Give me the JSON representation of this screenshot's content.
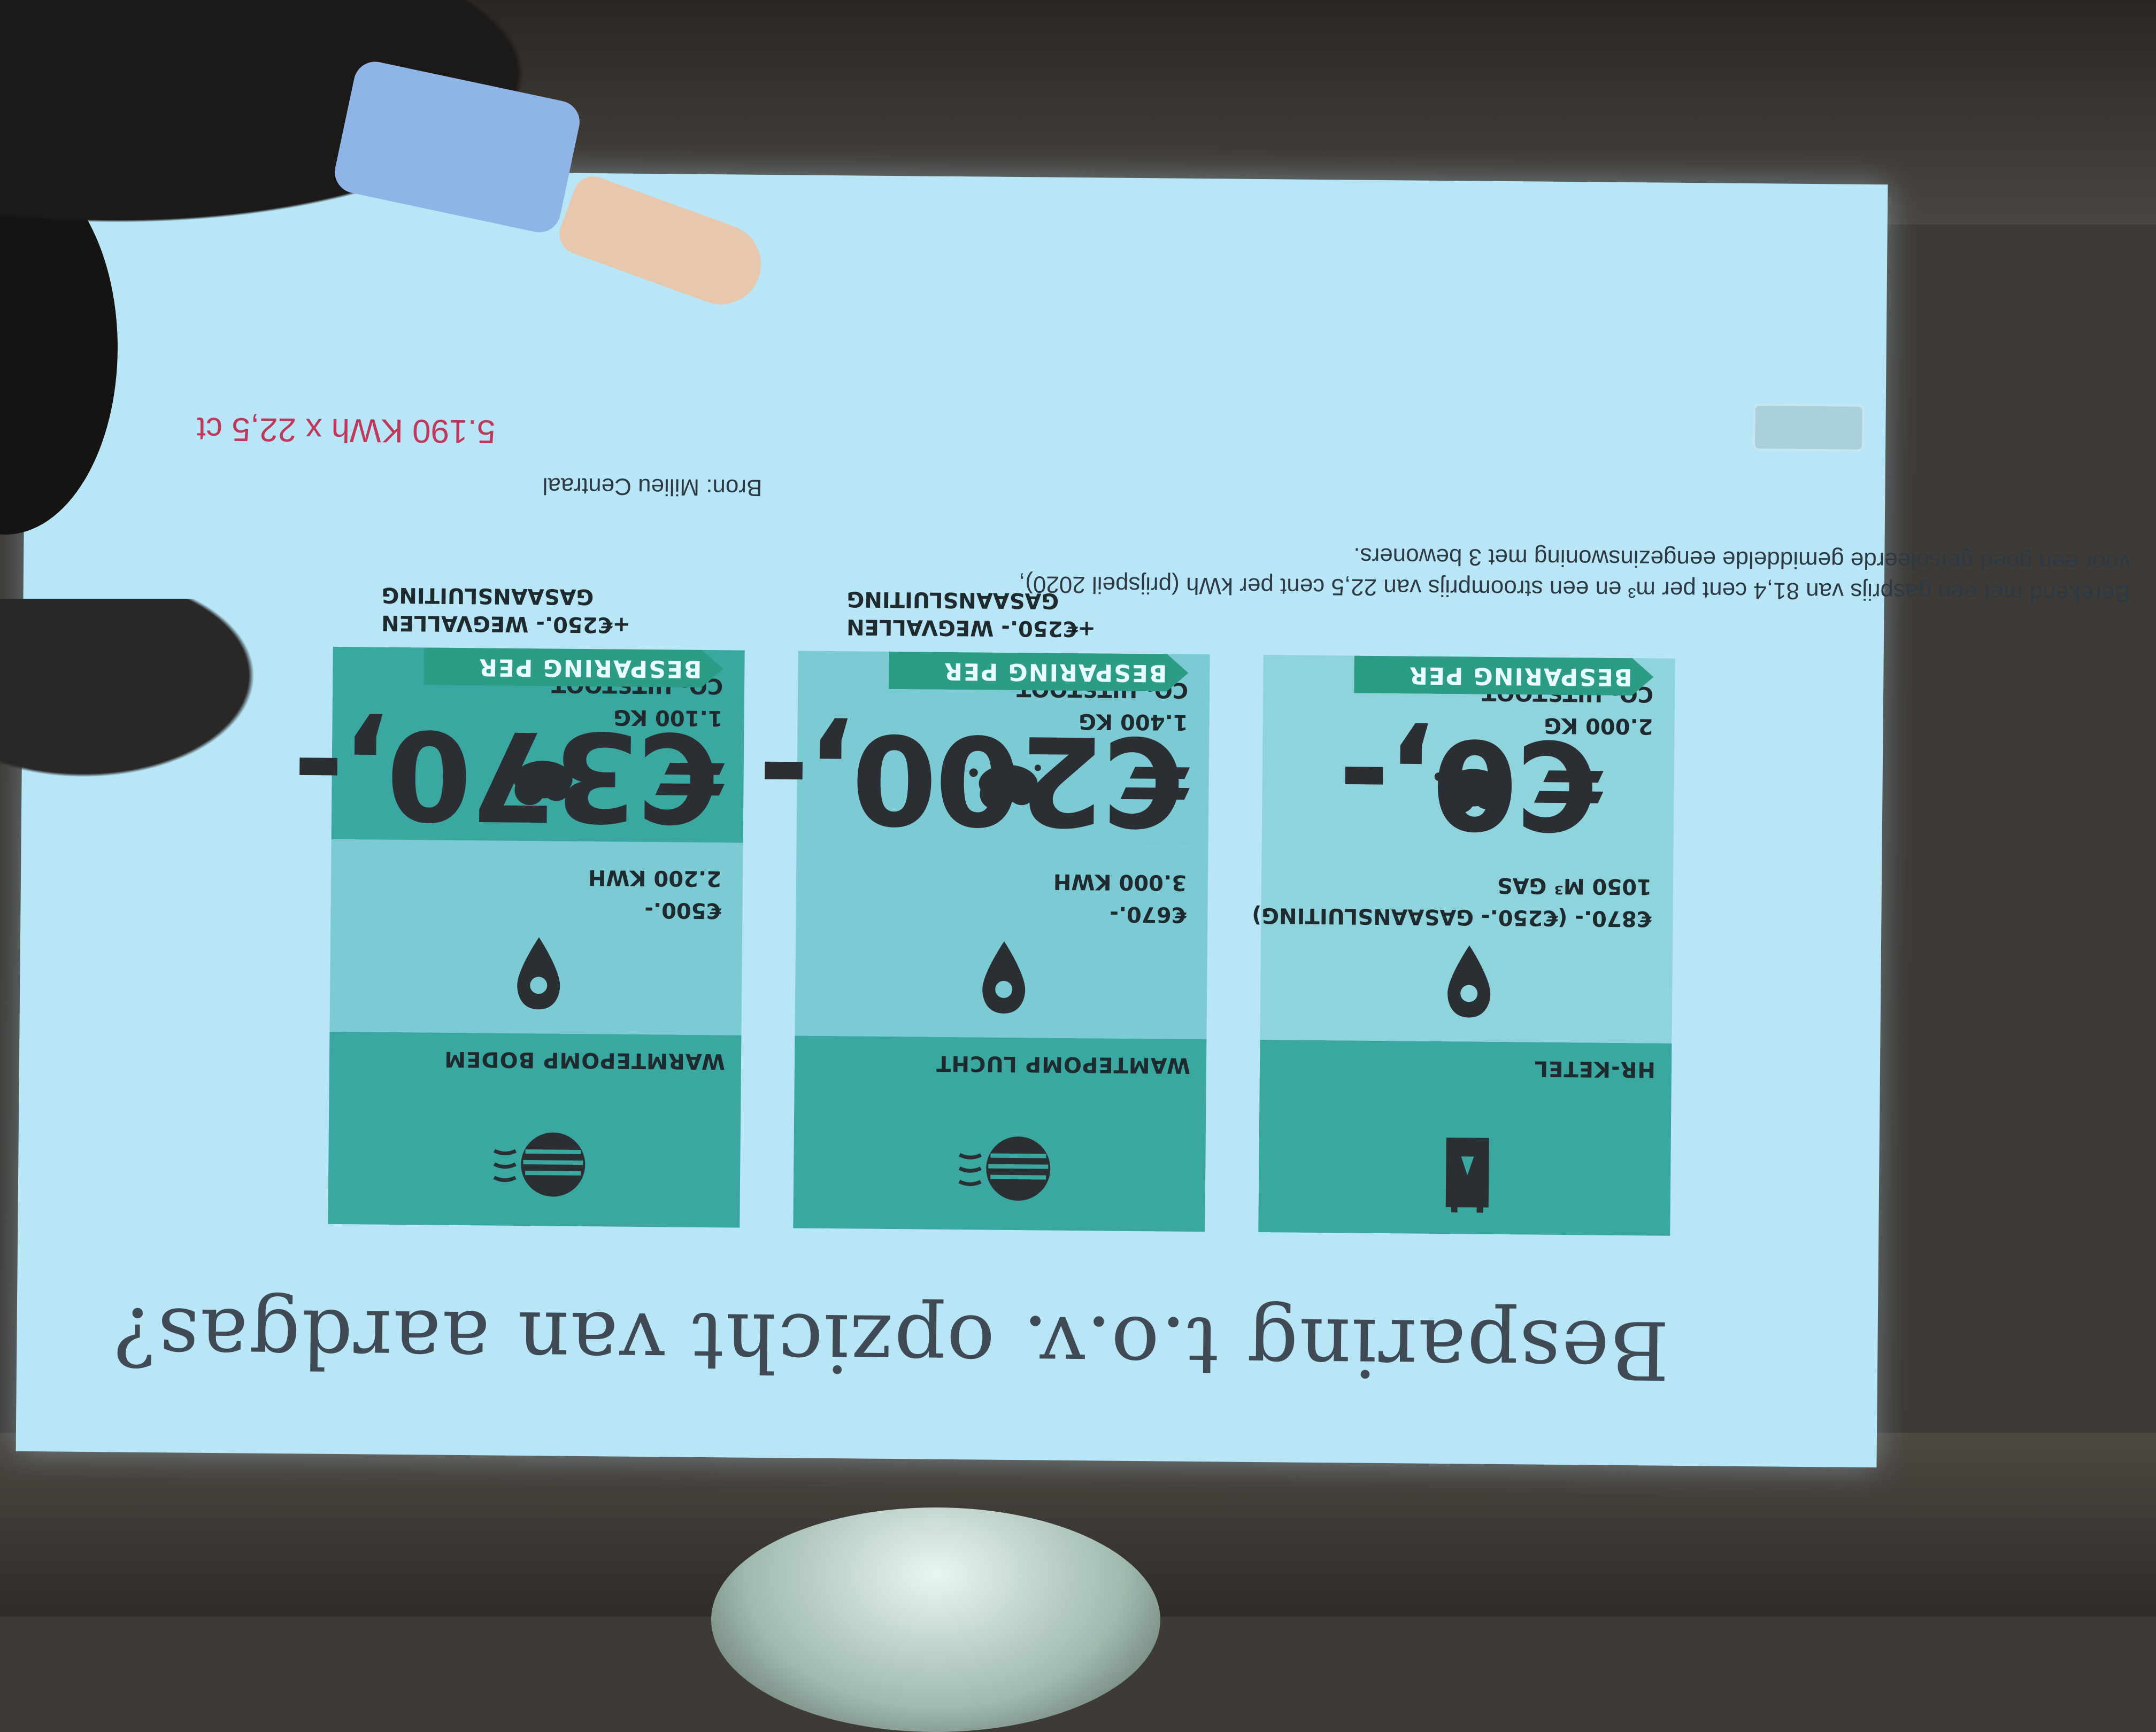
{
  "slide": {
    "title": "Besparing t.o.v. opzicht van aardgas?",
    "columns": [
      {
        "system_label": "HR-KETEL",
        "icon_system": "boiler-icon",
        "cost_line1": "€870.- (€250.- GASAANSLUITING)",
        "cost_line2": "1050 M³ GAS",
        "co2_line1": "2.000 KG",
        "co2_line2": "CO₂ UITSTOOT",
        "price": "€0,-",
        "banner": "BESPARING PER JAAR",
        "extra": ""
      },
      {
        "system_label": "WAMTEPOMP LUCHT",
        "icon_system": "heat-pump-air-icon",
        "cost_line1": "€670.-",
        "cost_line2": "3.000 KWH",
        "co2_line1": "1.400 KG",
        "co2_line2": "CO₂ UITSTOOT",
        "price": "€200,-",
        "banner": "BESPARING PER JAAR",
        "extra": "+€250.- WEGVALLEN GASAANSLUITING"
      },
      {
        "system_label": "WARMTEPOMP BODEM",
        "icon_system": "heat-pump-ground-icon",
        "cost_line1": "€500.-",
        "cost_line2": "2.200 KWH",
        "co2_line1": "1.100 KG",
        "co2_line2": "CO₂ UITSTOOT",
        "price": "€370,-",
        "banner": "BESPARING PER JAAR",
        "extra": "+€250.- WEGVALLEN GASAANSLUITING"
      }
    ],
    "footnote_line1": "Berekend met een gasprijs van 81,4 cent per m³ en een stroomprijs van 22,5 cent per kWh (prijspeil 2020),",
    "footnote_line2": "voor een goed geïsoleerde gemiddelde eengezinswoning met 3 bewoners.",
    "source": "Bron: Milieu Centraal",
    "handwritten_formula": "5.190 KWh x 22,5 ct",
    "colors": {
      "screen": "#b9e6f7",
      "teal_dark": "#3aa7a0",
      "teal_light": "#8fd3dd",
      "banner": "#2c9c86",
      "formula": "#c0375a"
    }
  }
}
